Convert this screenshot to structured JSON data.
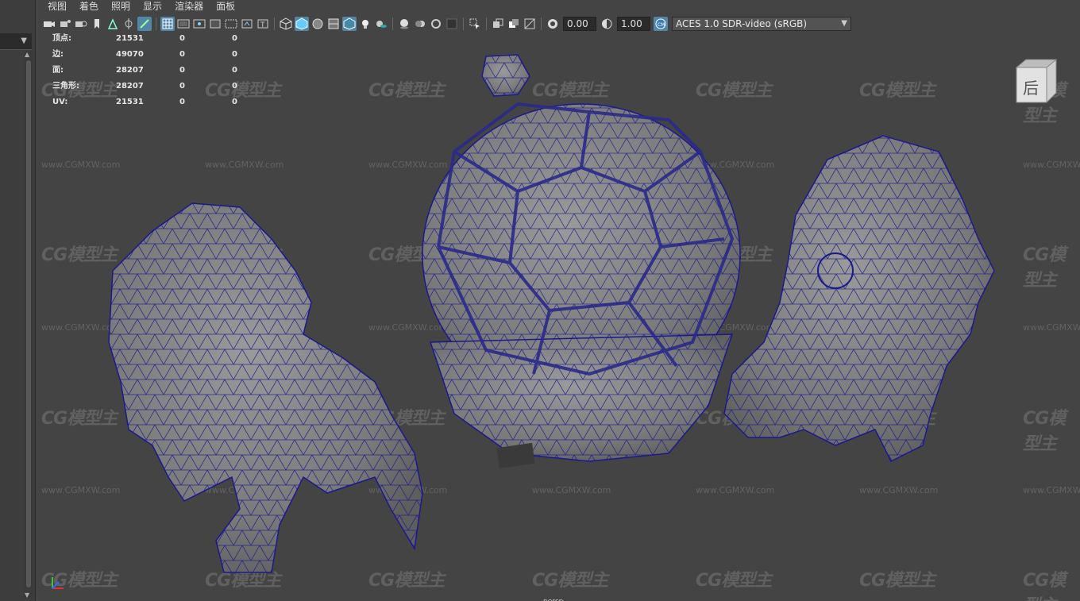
{
  "menubar": {
    "items": [
      "视图",
      "着色",
      "照明",
      "显示",
      "渲染器",
      "面板"
    ]
  },
  "toolbar": {
    "exposure": "0.00",
    "gamma": "1.00",
    "colorspace": "ACES 1.0 SDR-video (sRGB)",
    "icons": [
      "camera-select-icon",
      "camera-attributes-icon",
      "bookmarks-icon",
      "image-plane-icon",
      "2d-pan-zoom-icon",
      "grease-pencil-icon",
      "grid-icon",
      "film-gate-icon",
      "resolution-gate-icon",
      "gate-mask-icon",
      "field-chart-icon",
      "safe-action-icon",
      "safe-title-icon",
      "wireframe-icon",
      "smooth-shade-icon",
      "default-material-icon",
      "wireframe-on-shaded-icon",
      "textured-icon",
      "use-all-lights-icon",
      "shadows-icon",
      "screen-space-ao-icon",
      "motion-blur-icon",
      "anti-aliasing-icon",
      "depth-of-field-icon",
      "isolate-select-icon",
      "xray-icon",
      "xray-active-icon",
      "backface-culling-icon",
      "exposure-icon",
      "gamma-icon",
      "color-management-icon"
    ]
  },
  "heads_up": {
    "rows": [
      {
        "label": "顶点:",
        "a": "21531",
        "b": "0",
        "c": "0"
      },
      {
        "label": "边:",
        "a": "49070",
        "b": "0",
        "c": "0"
      },
      {
        "label": "面:",
        "a": "28207",
        "b": "0",
        "c": "0"
      },
      {
        "label": "三角形:",
        "a": "28207",
        "b": "0",
        "c": "0"
      },
      {
        "label": "UV:",
        "a": "21531",
        "b": "0",
        "c": "0"
      }
    ]
  },
  "viewport": {
    "camera_label": "persp",
    "viewcube_label": "后",
    "watermark_logo": "CG模型主",
    "watermark_url": "www.CGMXW.com",
    "wire_color": "#1a1a8c",
    "mesh_color": "#7d7d7d"
  }
}
